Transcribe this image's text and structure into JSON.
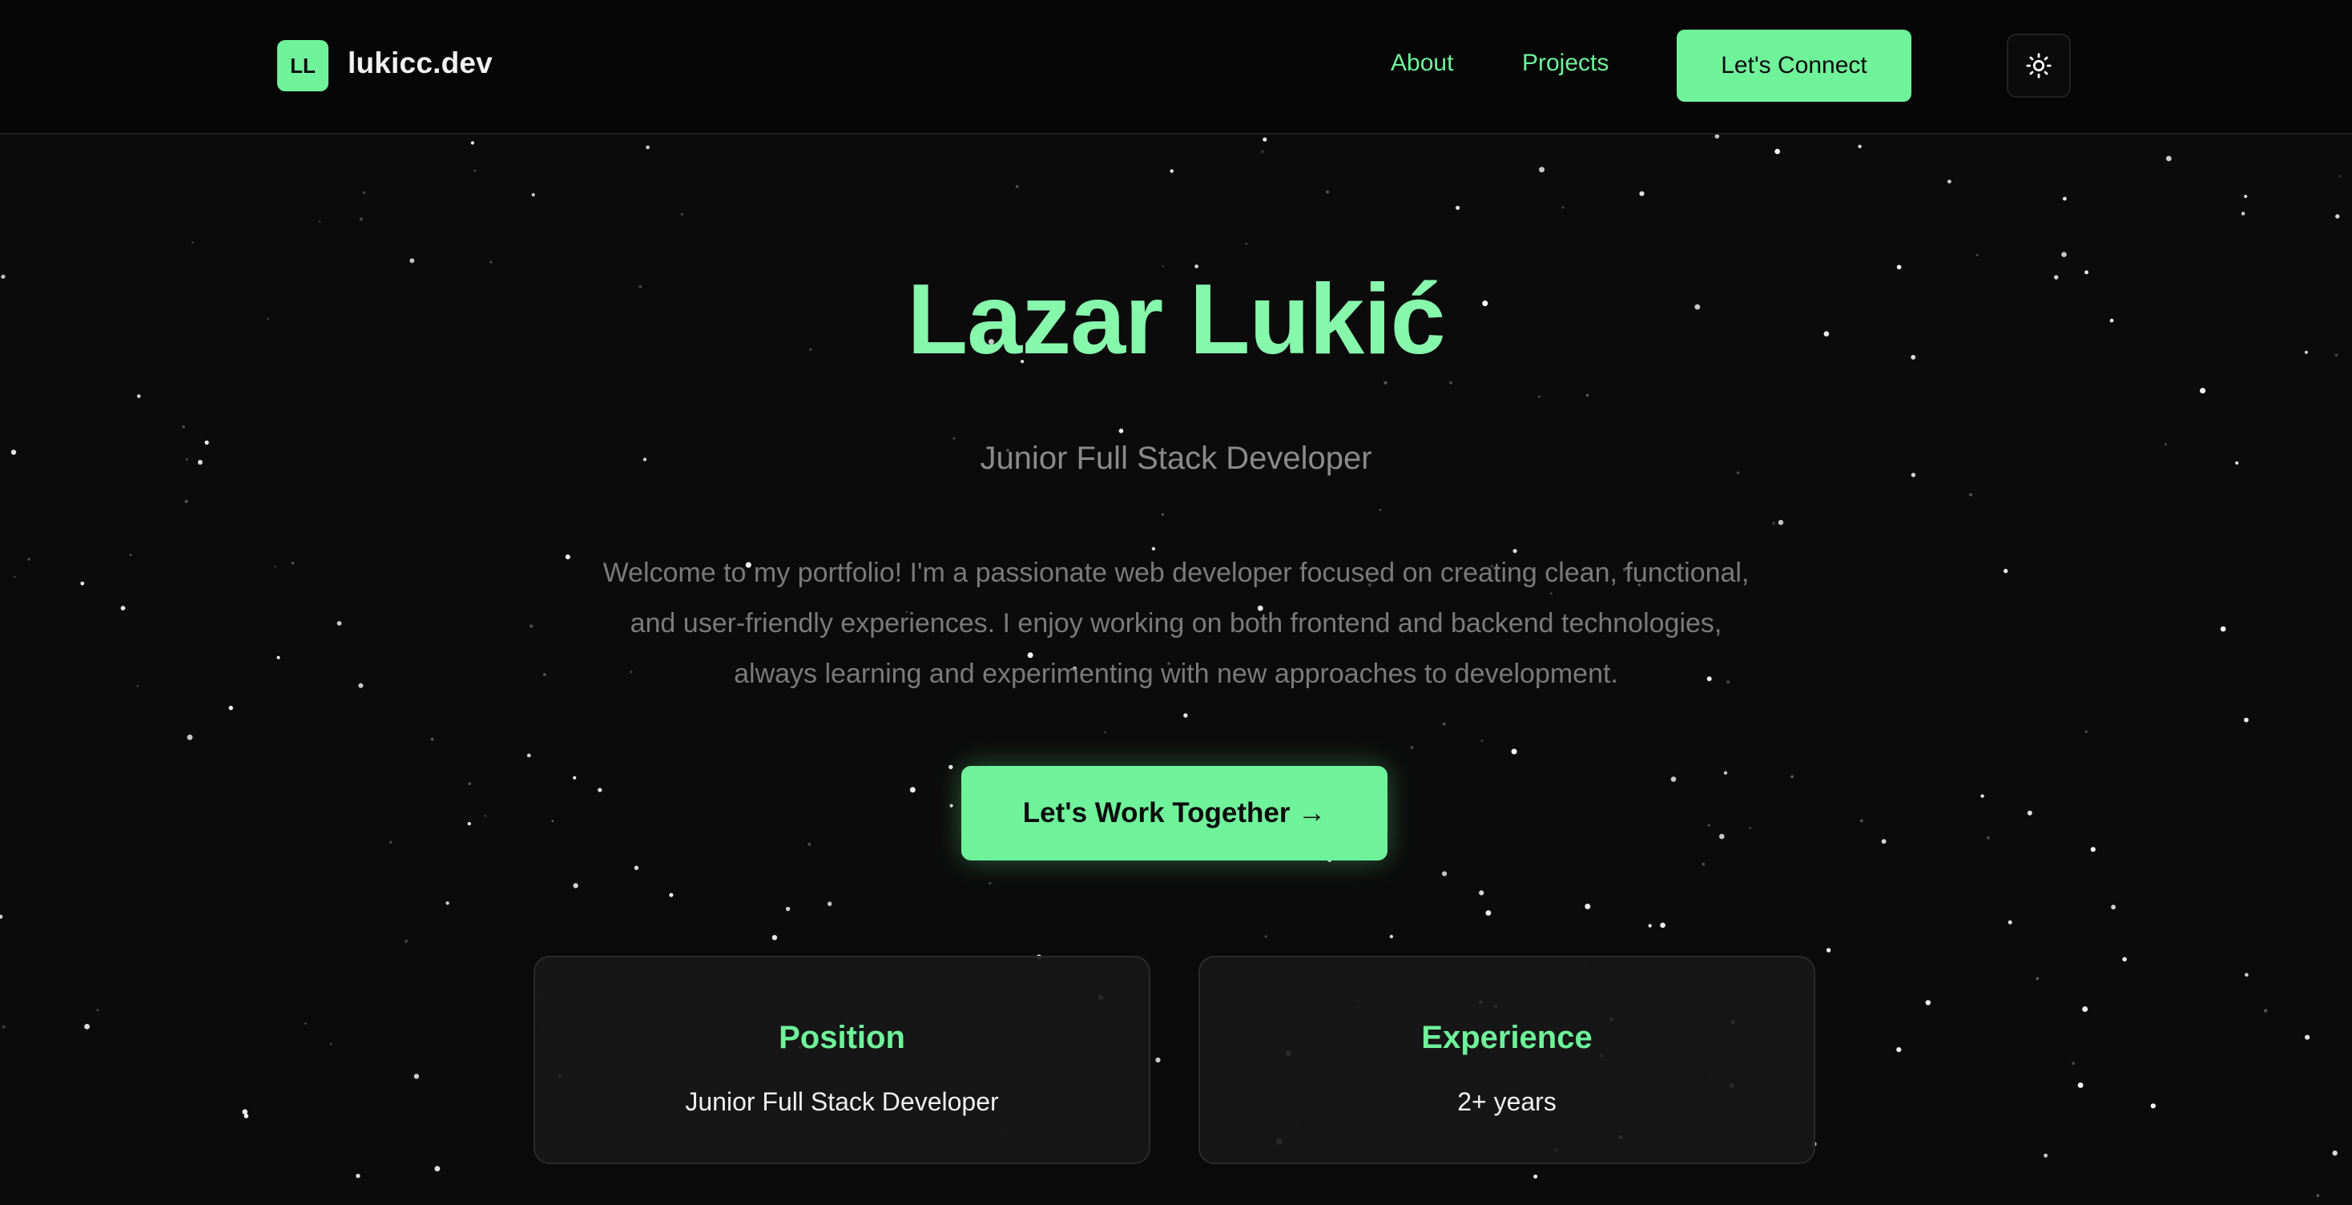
{
  "colors": {
    "accent": "#6ef29a",
    "heading": "#86f7ab",
    "background": "#0b0b0b",
    "header_background": "#060606",
    "muted_text": "#7a7a7a",
    "card_background": "#181818"
  },
  "header": {
    "logo_badge": "LL",
    "site_name": "lukicc.dev",
    "nav": {
      "about": "About",
      "projects": "Projects"
    },
    "connect_label": "Let's Connect",
    "theme_toggle_icon": "sun-icon"
  },
  "hero": {
    "name": "Lazar Lukić",
    "role": "Junior Full Stack Developer",
    "bio": "Welcome to my portfolio! I'm a passionate web developer focused on creating clean, functional, and user-friendly experiences. I enjoy working on both frontend and backend technologies, always learning and experimenting with new approaches to development.",
    "cta_label": "Let's Work Together →"
  },
  "cards": [
    {
      "title": "Position",
      "value": "Junior Full Stack Developer"
    },
    {
      "title": "Experience",
      "value": "2+ years"
    }
  ]
}
